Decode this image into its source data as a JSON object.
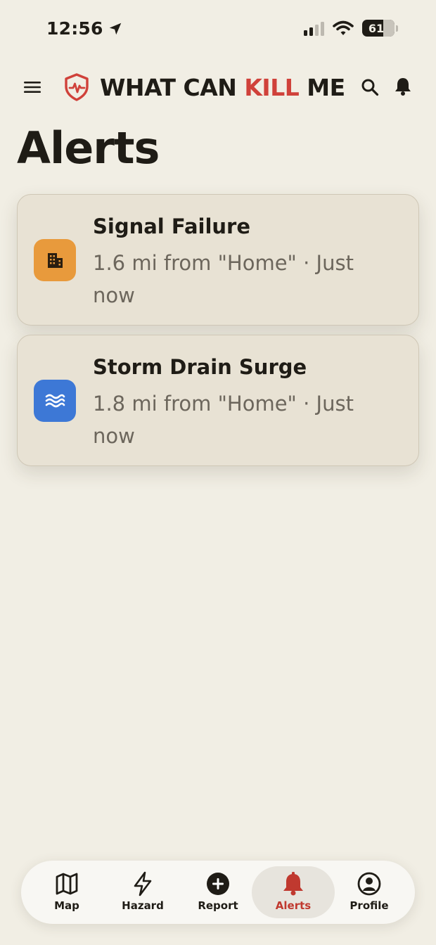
{
  "status_bar": {
    "time": "12:56",
    "battery_level": "61",
    "location_icon": "location-arrow-icon",
    "signal_icon": "cellular-signal-icon",
    "wifi_icon": "wifi-icon"
  },
  "header": {
    "title_part1": "WHAT CAN ",
    "title_part2": "KILL",
    "title_part3": " ME",
    "brand_color": "#d0413a"
  },
  "page": {
    "title": "Alerts"
  },
  "alerts": [
    {
      "title": "Signal Failure",
      "subtitle": "1.6 mi from \"Home\" · Just now",
      "icon": "building-icon",
      "color": "#e89a3c"
    },
    {
      "title": "Storm Drain Surge",
      "subtitle": "1.8 mi from \"Home\" · Just now",
      "icon": "water-waves-icon",
      "color": "#3d78d6"
    }
  ],
  "tabs": [
    {
      "label": "Map",
      "icon": "map-icon"
    },
    {
      "label": "Hazard",
      "icon": "lightning-icon"
    },
    {
      "label": "Report",
      "icon": "plus-circle-icon"
    },
    {
      "label": "Alerts",
      "icon": "bell-icon",
      "active": true
    },
    {
      "label": "Profile",
      "icon": "profile-icon"
    }
  ],
  "colors": {
    "background": "#f1eee4",
    "card": "#e8e2d4",
    "active_tab": "#c0392f"
  }
}
